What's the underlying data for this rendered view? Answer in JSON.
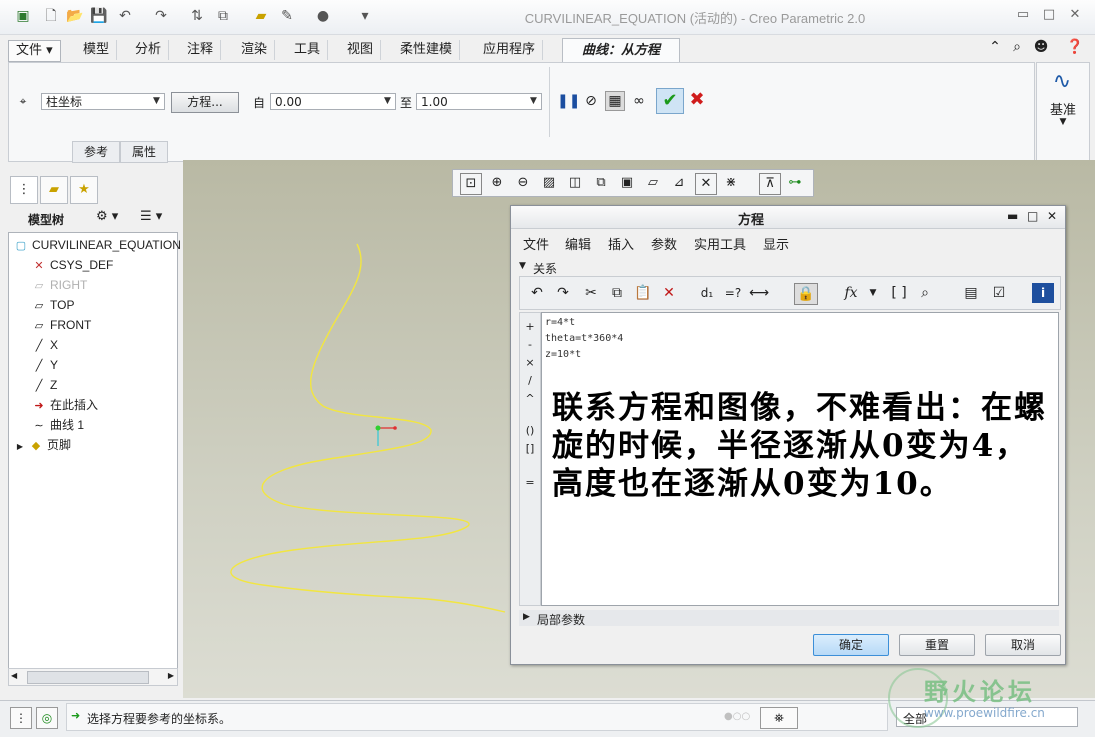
{
  "window": {
    "title": "CURVILINEAR_EQUATION (活动的) - Creo Parametric 2.0"
  },
  "ribbon": {
    "tabs": [
      "文件",
      "模型",
      "分析",
      "注释",
      "渲染",
      "工具",
      "视图",
      "柔性建模",
      "应用程序"
    ],
    "active_tab": "曲线：从方程",
    "coord_type": "柱坐标",
    "equation_button": "方程...",
    "from_label": "自",
    "from_value": "0.00",
    "to_label": "至",
    "to_value": "1.00",
    "subtabs": [
      "参考",
      "属性"
    ],
    "datum_label": "基准"
  },
  "model_tree": {
    "header": "模型树",
    "items": [
      {
        "label": "CURVILINEAR_EQUATION",
        "icon": "part-icon"
      },
      {
        "label": "CSYS_DEF",
        "icon": "csys-icon"
      },
      {
        "label": "RIGHT",
        "icon": "datum-plane-icon"
      },
      {
        "label": "TOP",
        "icon": "datum-plane-icon"
      },
      {
        "label": "FRONT",
        "icon": "datum-plane-icon"
      },
      {
        "label": "X",
        "icon": "axis-icon"
      },
      {
        "label": "Y",
        "icon": "axis-icon"
      },
      {
        "label": "Z",
        "icon": "axis-icon"
      },
      {
        "label": "在此插入",
        "icon": "insert-arrow-icon"
      },
      {
        "label": "曲线 1",
        "icon": "curve-icon"
      },
      {
        "label": "页脚",
        "icon": "footer-icon"
      }
    ]
  },
  "dialog": {
    "title": "方程",
    "menu": [
      "文件",
      "编辑",
      "插入",
      "参数",
      "实用工具",
      "显示"
    ],
    "section_relations": "关系",
    "equations": [
      "r=4*t",
      "theta=t*360*4",
      "z=10*t"
    ],
    "annotation": "联系方程和图像，不难看出：在螺旋的时候，半径逐渐从0变为4，高度也在逐渐从0变为10。",
    "section_local": "局部参数",
    "left_ops": [
      "+",
      "-",
      "×",
      "/",
      "^",
      "()",
      "[]",
      "="
    ],
    "buttons": {
      "ok": "确定",
      "reset": "重置",
      "cancel": "取消"
    }
  },
  "status": {
    "message": "选择方程要参考的坐标系。",
    "filter": "全部"
  },
  "watermark": {
    "text": "野火论坛",
    "url": "www.proewildfire.cn"
  },
  "colors": {
    "accent": "#2a6fc9",
    "curve": "#f2e640",
    "ok_green": "#1c9a1c",
    "cancel_red": "#d01c1c"
  }
}
